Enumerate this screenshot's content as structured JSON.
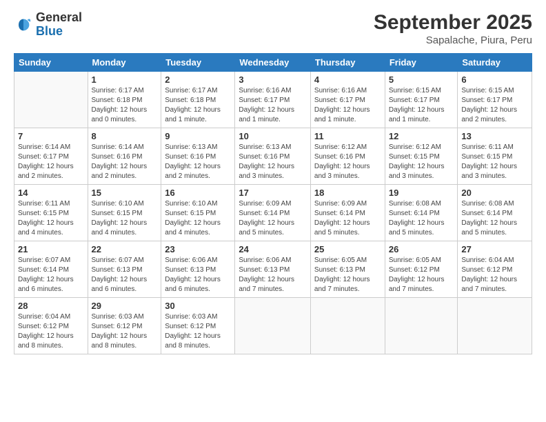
{
  "logo": {
    "text_general": "General",
    "text_blue": "Blue"
  },
  "header": {
    "month": "September 2025",
    "location": "Sapalache, Piura, Peru"
  },
  "weekdays": [
    "Sunday",
    "Monday",
    "Tuesday",
    "Wednesday",
    "Thursday",
    "Friday",
    "Saturday"
  ],
  "weeks": [
    [
      {
        "day": "",
        "info": ""
      },
      {
        "day": "1",
        "info": "Sunrise: 6:17 AM\nSunset: 6:18 PM\nDaylight: 12 hours\nand 0 minutes."
      },
      {
        "day": "2",
        "info": "Sunrise: 6:17 AM\nSunset: 6:18 PM\nDaylight: 12 hours\nand 1 minute."
      },
      {
        "day": "3",
        "info": "Sunrise: 6:16 AM\nSunset: 6:17 PM\nDaylight: 12 hours\nand 1 minute."
      },
      {
        "day": "4",
        "info": "Sunrise: 6:16 AM\nSunset: 6:17 PM\nDaylight: 12 hours\nand 1 minute."
      },
      {
        "day": "5",
        "info": "Sunrise: 6:15 AM\nSunset: 6:17 PM\nDaylight: 12 hours\nand 1 minute."
      },
      {
        "day": "6",
        "info": "Sunrise: 6:15 AM\nSunset: 6:17 PM\nDaylight: 12 hours\nand 2 minutes."
      }
    ],
    [
      {
        "day": "7",
        "info": "Sunrise: 6:14 AM\nSunset: 6:17 PM\nDaylight: 12 hours\nand 2 minutes."
      },
      {
        "day": "8",
        "info": "Sunrise: 6:14 AM\nSunset: 6:16 PM\nDaylight: 12 hours\nand 2 minutes."
      },
      {
        "day": "9",
        "info": "Sunrise: 6:13 AM\nSunset: 6:16 PM\nDaylight: 12 hours\nand 2 minutes."
      },
      {
        "day": "10",
        "info": "Sunrise: 6:13 AM\nSunset: 6:16 PM\nDaylight: 12 hours\nand 3 minutes."
      },
      {
        "day": "11",
        "info": "Sunrise: 6:12 AM\nSunset: 6:16 PM\nDaylight: 12 hours\nand 3 minutes."
      },
      {
        "day": "12",
        "info": "Sunrise: 6:12 AM\nSunset: 6:15 PM\nDaylight: 12 hours\nand 3 minutes."
      },
      {
        "day": "13",
        "info": "Sunrise: 6:11 AM\nSunset: 6:15 PM\nDaylight: 12 hours\nand 3 minutes."
      }
    ],
    [
      {
        "day": "14",
        "info": "Sunrise: 6:11 AM\nSunset: 6:15 PM\nDaylight: 12 hours\nand 4 minutes."
      },
      {
        "day": "15",
        "info": "Sunrise: 6:10 AM\nSunset: 6:15 PM\nDaylight: 12 hours\nand 4 minutes."
      },
      {
        "day": "16",
        "info": "Sunrise: 6:10 AM\nSunset: 6:15 PM\nDaylight: 12 hours\nand 4 minutes."
      },
      {
        "day": "17",
        "info": "Sunrise: 6:09 AM\nSunset: 6:14 PM\nDaylight: 12 hours\nand 5 minutes."
      },
      {
        "day": "18",
        "info": "Sunrise: 6:09 AM\nSunset: 6:14 PM\nDaylight: 12 hours\nand 5 minutes."
      },
      {
        "day": "19",
        "info": "Sunrise: 6:08 AM\nSunset: 6:14 PM\nDaylight: 12 hours\nand 5 minutes."
      },
      {
        "day": "20",
        "info": "Sunrise: 6:08 AM\nSunset: 6:14 PM\nDaylight: 12 hours\nand 5 minutes."
      }
    ],
    [
      {
        "day": "21",
        "info": "Sunrise: 6:07 AM\nSunset: 6:14 PM\nDaylight: 12 hours\nand 6 minutes."
      },
      {
        "day": "22",
        "info": "Sunrise: 6:07 AM\nSunset: 6:13 PM\nDaylight: 12 hours\nand 6 minutes."
      },
      {
        "day": "23",
        "info": "Sunrise: 6:06 AM\nSunset: 6:13 PM\nDaylight: 12 hours\nand 6 minutes."
      },
      {
        "day": "24",
        "info": "Sunrise: 6:06 AM\nSunset: 6:13 PM\nDaylight: 12 hours\nand 7 minutes."
      },
      {
        "day": "25",
        "info": "Sunrise: 6:05 AM\nSunset: 6:13 PM\nDaylight: 12 hours\nand 7 minutes."
      },
      {
        "day": "26",
        "info": "Sunrise: 6:05 AM\nSunset: 6:12 PM\nDaylight: 12 hours\nand 7 minutes."
      },
      {
        "day": "27",
        "info": "Sunrise: 6:04 AM\nSunset: 6:12 PM\nDaylight: 12 hours\nand 7 minutes."
      }
    ],
    [
      {
        "day": "28",
        "info": "Sunrise: 6:04 AM\nSunset: 6:12 PM\nDaylight: 12 hours\nand 8 minutes."
      },
      {
        "day": "29",
        "info": "Sunrise: 6:03 AM\nSunset: 6:12 PM\nDaylight: 12 hours\nand 8 minutes."
      },
      {
        "day": "30",
        "info": "Sunrise: 6:03 AM\nSunset: 6:12 PM\nDaylight: 12 hours\nand 8 minutes."
      },
      {
        "day": "",
        "info": ""
      },
      {
        "day": "",
        "info": ""
      },
      {
        "day": "",
        "info": ""
      },
      {
        "day": "",
        "info": ""
      }
    ]
  ]
}
